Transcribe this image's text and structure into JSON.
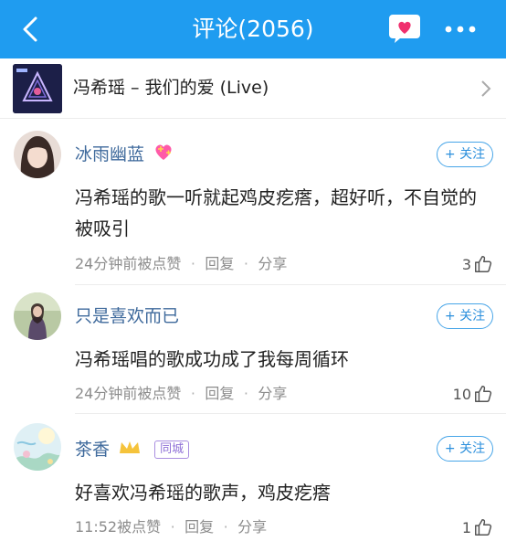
{
  "header": {
    "title": "评论(2056)",
    "background": "#1f9cf0"
  },
  "song": {
    "title": "冯希瑶 – 我们的爱 (Live)"
  },
  "comments": [
    {
      "nickname": "冰雨幽蓝",
      "follow_label": "+ 关注",
      "text": "冯希瑶的歌一听就起鸡皮疙瘩，超好听，不自觉的被吸引",
      "time": "24分钟前被点赞",
      "reply_label": "回复",
      "share_label": "分享",
      "likes": "3"
    },
    {
      "nickname": "只是喜欢而已",
      "follow_label": "+ 关注",
      "text": "冯希瑶唱的歌成功成了我每周循环",
      "time": "24分钟前被点赞",
      "reply_label": "回复",
      "share_label": "分享",
      "likes": "10"
    },
    {
      "nickname": "茶香",
      "badge": "同城",
      "follow_label": "+ 关注",
      "text": "好喜欢冯希瑶的歌声，鸡皮疙瘩",
      "time": "11:52被点赞",
      "reply_label": "回复",
      "share_label": "分享",
      "likes": "1"
    }
  ],
  "meta_separator": "·",
  "icons": [
    "back-arrow-icon",
    "heart-message-icon",
    "more-dots-icon",
    "chevron-right-icon",
    "thumbs-up-icon",
    "sparkling-heart-icon",
    "crown-icon"
  ]
}
